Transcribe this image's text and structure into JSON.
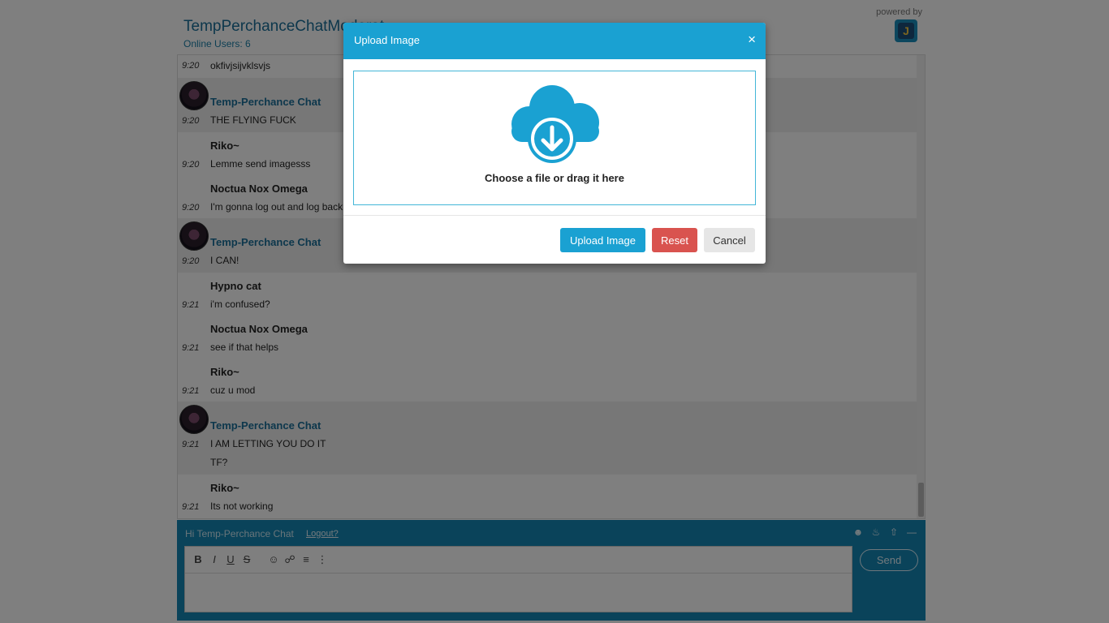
{
  "header": {
    "room_title": "TempPerchanceChatModerat",
    "online_users": "Online Users: 6",
    "powered_by": "powered by",
    "logo_letter": "J"
  },
  "messages": [
    {
      "time": "9:20",
      "author": "",
      "text": "okfivjsijvklsvjs",
      "shaded": false
    },
    {
      "time": "9:20",
      "author": "Temp-Perchance Chat",
      "text": "THE FLYING FUCK",
      "shaded": true,
      "op": true
    },
    {
      "time": "9:20",
      "author": "Riko~",
      "text": "Lemme send imagesss",
      "shaded": false
    },
    {
      "time": "9:20",
      "author": "Noctua Nox Omega",
      "text": "I'm gonna log out and log back",
      "shaded": false
    },
    {
      "time": "9:20",
      "author": "Temp-Perchance Chat",
      "text": "I CAN!",
      "shaded": true,
      "op": true
    },
    {
      "time": "9:21",
      "author": "Hypno cat",
      "text": "i'm confused?",
      "shaded": false
    },
    {
      "time": "9:21",
      "author": "Noctua Nox Omega",
      "text": "see if that helps",
      "shaded": false
    },
    {
      "time": "9:21",
      "author": "Riko~",
      "text": "cuz u mod",
      "shaded": false
    },
    {
      "time": "9:21",
      "author": "Temp-Perchance Chat",
      "text": "I AM LETTING YOU DO IT",
      "text2": "TF?",
      "shaded": true,
      "op": true
    },
    {
      "time": "9:21",
      "author": "Riko~",
      "text": "Its not working",
      "shaded": false
    }
  ],
  "compose": {
    "greeting": "Hi Temp-Perchance Chat",
    "logout": "Logout?",
    "send": "Send",
    "toolbar": [
      "B",
      "I",
      "U",
      "S"
    ]
  },
  "modal": {
    "title": "Upload Image",
    "close": "×",
    "dropzone_text": "Choose a file or drag it here",
    "upload_button": "Upload Image",
    "reset_button": "Reset",
    "cancel_button": "Cancel"
  },
  "colors": {
    "accent": "#1aa1d2",
    "reset": "#d9534f",
    "compose_bg": "#1487b5"
  }
}
